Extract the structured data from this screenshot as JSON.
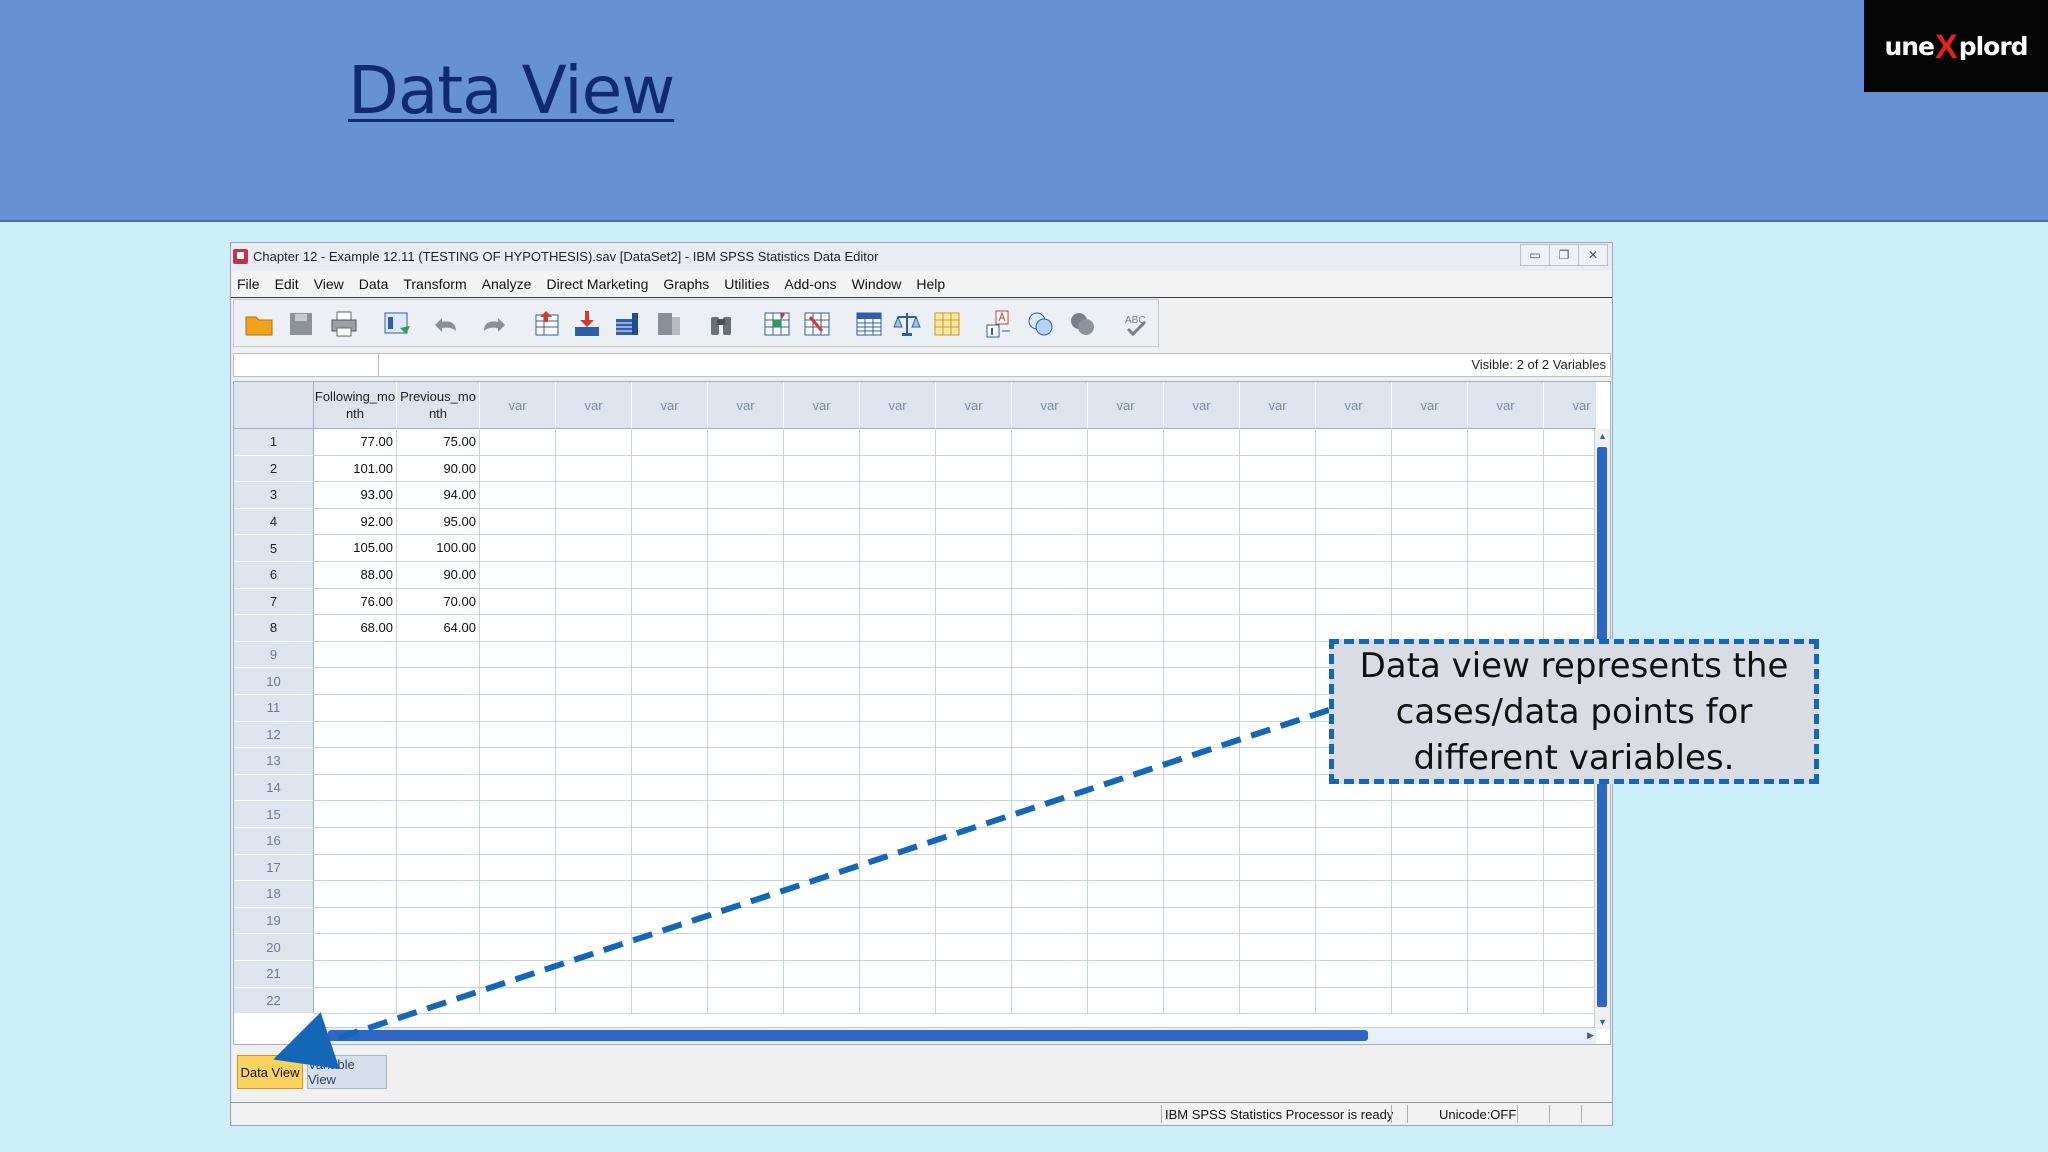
{
  "slide": {
    "title": "Data View",
    "logo": {
      "left": "une",
      "x": "X",
      "right": "plord"
    },
    "callout": "Data view represents the cases/data points for different variables."
  },
  "window": {
    "title": "Chapter 12 - Example 12.11 (TESTING OF HYPOTHESIS).sav [DataSet2] - IBM SPSS Statistics Data Editor",
    "controls": {
      "minimize": "▭",
      "restore": "❐",
      "close": "✕"
    }
  },
  "menu": [
    "File",
    "Edit",
    "View",
    "Data",
    "Transform",
    "Analyze",
    "Direct Marketing",
    "Graphs",
    "Utilities",
    "Add-ons",
    "Window",
    "Help"
  ],
  "toolbar_icons": [
    "open-folder-icon",
    "save-icon",
    "print-icon",
    "dialog-recall-icon",
    "undo-icon",
    "redo-icon",
    "goto-case-icon",
    "goto-variable-icon",
    "variables-icon",
    "run-descriptives-icon",
    "find-icon",
    "insert-cases-icon",
    "insert-variable-icon",
    "split-file-icon",
    "weight-cases-icon",
    "select-cases-icon",
    "value-labels-icon",
    "use-variable-sets-icon",
    "show-all-variables-icon",
    "spell-check-icon"
  ],
  "visible_variables": "Visible: 2 of 2 Variables",
  "grid": {
    "columns": [
      "Following_mo nth",
      "Previous_mo nth",
      "var",
      "var",
      "var",
      "var",
      "var",
      "var",
      "var",
      "var",
      "var",
      "var",
      "var",
      "var",
      "var",
      "var",
      "var"
    ],
    "rows": [
      "1",
      "2",
      "3",
      "4",
      "5",
      "6",
      "7",
      "8",
      "9",
      "10",
      "11",
      "12",
      "13",
      "14",
      "15",
      "16",
      "17",
      "18",
      "19",
      "20",
      "21",
      "22"
    ],
    "data": [
      [
        "77.00",
        "75.00"
      ],
      [
        "101.00",
        "90.00"
      ],
      [
        "93.00",
        "94.00"
      ],
      [
        "92.00",
        "95.00"
      ],
      [
        "105.00",
        "100.00"
      ],
      [
        "88.00",
        "90.00"
      ],
      [
        "76.00",
        "70.00"
      ],
      [
        "68.00",
        "64.00"
      ]
    ]
  },
  "tabs": {
    "data_view": "Data View",
    "variable_view": "Variable View"
  },
  "status": {
    "processor": "IBM SPSS Statistics Processor is ready",
    "unicode": "Unicode:OFF"
  }
}
